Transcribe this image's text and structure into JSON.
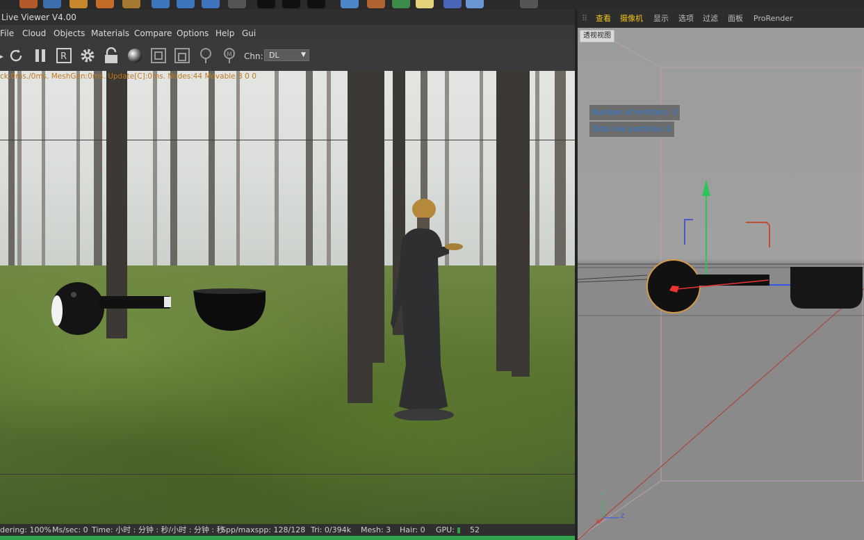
{
  "left_viewer": {
    "title": "Live Viewer V4.00",
    "menu": [
      "File",
      "Cloud",
      "Objects",
      "Materials",
      "Compare",
      "Options",
      "Help",
      "Gui"
    ],
    "toolbar_icons": [
      "refresh-icon",
      "pause-icon",
      "region-render-icon",
      "settings-gear-icon",
      "lock-icon",
      "material-sphere-icon",
      "pick-focus-icon",
      "pick-material-icon",
      "pin-icon",
      "pin-m-icon"
    ],
    "channel_label": "Chn:",
    "channel_value": "DL",
    "stats_line": "ck:0ms./0ms. MeshGen:0ms. Update[C]:0ms. Nodes:44 Movable:3  0 0",
    "status": {
      "rendering": "dering: 100%",
      "ms_sec": "Ms/sec: 0",
      "time": "Time: 小时 : 分钟 : 秒/小时 : 分钟 : 秒",
      "spp": "Spp/maxspp: 128/128",
      "tri": "Tri: 0/394k",
      "mesh": "Mesh: 3",
      "hair": "Hair: 0",
      "gpu_label": "GPU:",
      "gpu_value": "52"
    }
  },
  "right_viewport": {
    "tabs": [
      "查看",
      "摄像机",
      "显示",
      "选项",
      "过滤",
      "面板",
      "ProRender"
    ],
    "active_tabs": [
      "查看",
      "摄像机"
    ],
    "view_label": "透视视图",
    "hud_emitters": "Number of emitters: 0",
    "hud_particles": "Total live particles: 0",
    "axis_labels": {
      "y": "Y",
      "x": "X",
      "z": "Z"
    }
  },
  "colors": {
    "menu_bg": "#393939",
    "status_green": "#31a34a",
    "stats_orange": "#c0781c",
    "hud_text": "#2a79d4",
    "axis_x": "#e03030",
    "axis_y": "#2fc45a",
    "axis_z": "#3355ee"
  }
}
